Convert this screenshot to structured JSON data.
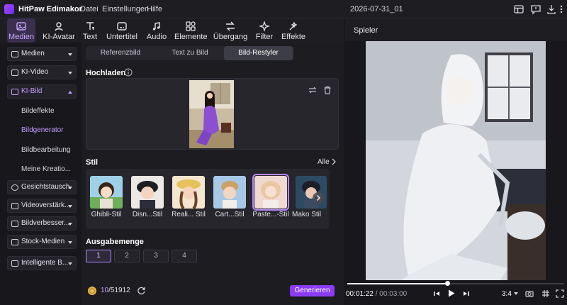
{
  "app": {
    "name": "HitPaw Edimakor",
    "menus": [
      "Datei",
      "Einstellungen",
      "Hilfe"
    ],
    "project": "2026-07-31_01"
  },
  "toolbar": {
    "tools": [
      "Medien",
      "KI-Avatar",
      "Text",
      "Untertitel",
      "Audio",
      "Elemente",
      "Übergang",
      "Filter",
      "Effekte"
    ]
  },
  "sidebar": {
    "items": [
      "Medien",
      "KI-Video",
      "KI-Bild",
      "Gesichtstausch",
      "Videoverstärk...",
      "Bildverbesser...",
      "Stock-Medien",
      "Intelligente B..."
    ],
    "subitems": [
      "Bildeffekte",
      "Bildgenerator",
      "Bildbearbeitung",
      "Meine Kreatio..."
    ]
  },
  "tabs": [
    "Referenzbild",
    "Text zu Bild",
    "Bild-Restyler"
  ],
  "upload": {
    "label": "Hochladen"
  },
  "style": {
    "label": "Stil",
    "all": "Alle",
    "items": [
      "Ghibli-Stil",
      "Disn...Stil",
      "Reali... Stil",
      "Cart...Stil",
      "Paste...-Stil",
      "Mako Stil"
    ]
  },
  "output": {
    "label": "Ausgabemenge",
    "options": [
      "1",
      "2",
      "3",
      "4"
    ]
  },
  "credits": {
    "used": "10",
    "total": "/51912"
  },
  "generate": "Generieren",
  "player": {
    "label": "Spieler",
    "current": "00:01:22",
    "total": "/ 00:03:00",
    "ratio": "3:4",
    "progress": 0.46
  },
  "colors": {
    "accent": "#8b3cf4",
    "highlight": "#c79bff"
  },
  "icons": [
    "info-icon",
    "swap-icon",
    "trash-icon",
    "chevron-right-icon",
    "refresh-icon",
    "coin-icon",
    "play-icon",
    "prev-frame-icon",
    "next-frame-icon",
    "camera-icon",
    "grid-icon",
    "fullscreen-icon"
  ]
}
